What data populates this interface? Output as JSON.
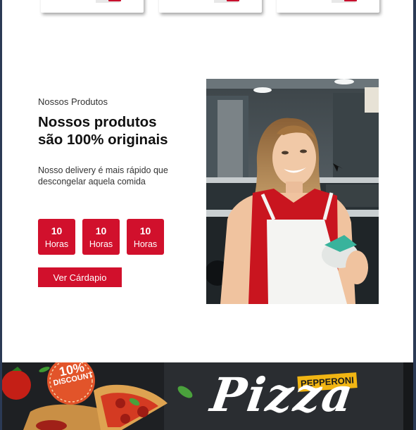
{
  "products_section": {
    "subtitle": "Nossos Produtos",
    "headline_line1": "Nossos produtos",
    "headline_line2": "são 100% originais",
    "description": "Nosso delivery é mais rápido que descongelar aquela comida",
    "stats": [
      {
        "value": "10",
        "unit": "Horas"
      },
      {
        "value": "10",
        "unit": "Horas"
      },
      {
        "value": "10",
        "unit": "Horas"
      }
    ],
    "cta_label": "Ver Cárdapio"
  },
  "banner": {
    "discount_pct": "10%",
    "discount_label": "DISCOUNT",
    "tag": "PEPPERONI",
    "title": "Pizza"
  },
  "colors": {
    "accent": "#d1102c",
    "frame": "#2b3a55"
  }
}
